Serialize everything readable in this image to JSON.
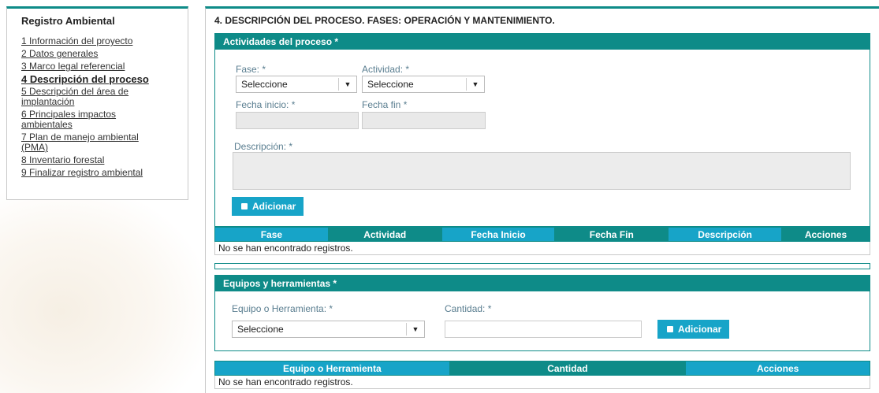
{
  "sidebar": {
    "title": "Registro Ambiental",
    "items": [
      {
        "label": "1 Información del proyecto"
      },
      {
        "label": "2 Datos generales"
      },
      {
        "label": "3 Marco legal referencial"
      },
      {
        "label": "4 Descripción del proceso"
      },
      {
        "label": "5 Descripción del área de implantación"
      },
      {
        "label": "6 Principales impactos ambientales"
      },
      {
        "label": "7 Plan de manejo ambiental (PMA)"
      },
      {
        "label": "8 Inventario forestal"
      },
      {
        "label": "9 Finalizar registro ambiental"
      }
    ]
  },
  "main": {
    "title": "4. DESCRIPCIÓN DEL PROCESO. FASES: OPERACIÓN Y MANTENIMIENTO."
  },
  "activities": {
    "header": "Actividades del proceso *",
    "fase_label": "Fase:  *",
    "fase_value": "Seleccione",
    "actividad_label": "Actividad:  *",
    "actividad_value": "Seleccione",
    "fecha_inicio_label": "Fecha inicio:  *",
    "fecha_fin_label": "Fecha fin  *",
    "descripcion_label": "Descripción:  *",
    "add_button": "Adicionar",
    "table_columns": [
      "Fase",
      "Actividad",
      "Fecha Inicio",
      "Fecha Fin",
      "Descripción",
      "Acciones"
    ],
    "empty_message": "No se han encontrado registros."
  },
  "equipment": {
    "header": "Equipos y herramientas *",
    "equipo_label": "Equipo o Herramienta:  *",
    "equipo_value": "Seleccione",
    "cantidad_label": "Cantidad:  *",
    "add_button": "Adicionar",
    "table_columns": [
      "Equipo o Herramienta",
      "Cantidad",
      "Acciones"
    ],
    "empty_message": "No se han encontrado registros."
  },
  "icons": {
    "dropdown": "chevron-down-icon",
    "add": "save-icon"
  },
  "colors": {
    "teal": "#0e8b88",
    "cyan": "#17a4c8",
    "label": "#5a7e90"
  }
}
